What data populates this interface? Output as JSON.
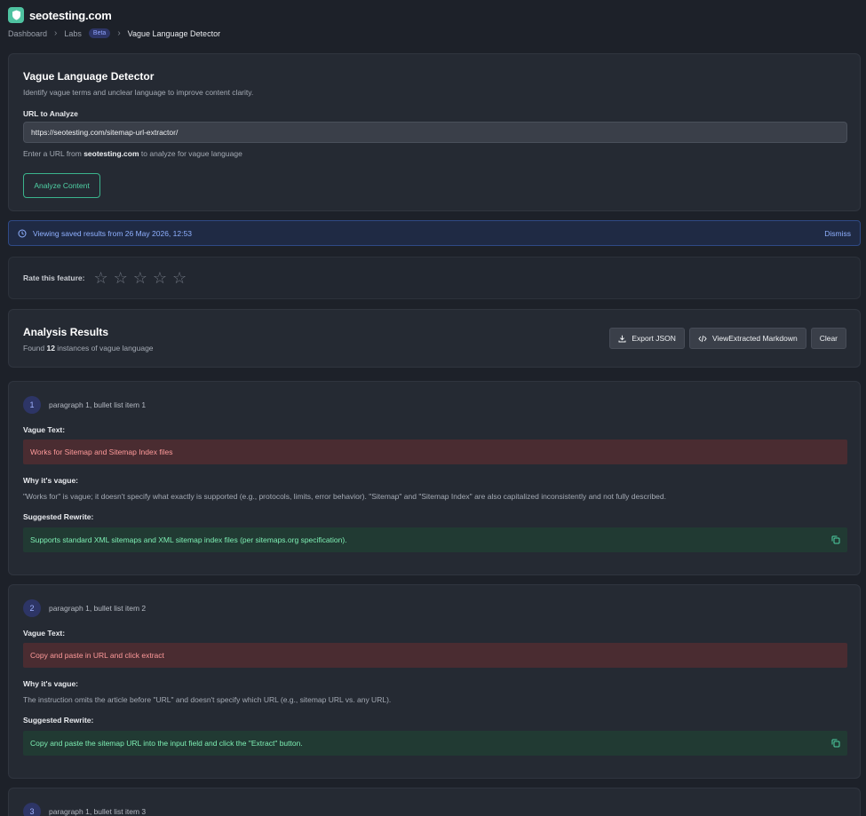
{
  "brand": {
    "name": "seotesting.com",
    "logo_icon": "shield-icon",
    "accent": "#4fc3a1"
  },
  "breadcrumb": {
    "items": [
      "Dashboard",
      "Labs"
    ],
    "badge": "Beta",
    "current": "Vague Language Detector"
  },
  "tool": {
    "title": "Vague Language Detector",
    "description": "Identify vague terms and unclear language to improve content clarity.",
    "url_label": "URL to Analyze",
    "url_value": "https://seotesting.com/sitemap-url-extractor/",
    "hint_prefix": "Enter a URL from ",
    "hint_domain": "seotesting.com",
    "hint_suffix": " to analyze for vague language",
    "analyze_label": "Analyze Content"
  },
  "saved_notice": {
    "text": "Viewing saved results from 26 May 2026, 12:53",
    "dismiss_label": "Dismiss"
  },
  "rating": {
    "label": "Rate this feature:",
    "max": 5,
    "value": 0
  },
  "results": {
    "title": "Analysis Results",
    "found_prefix": "Found ",
    "count": "12",
    "found_suffix": " instances of vague language",
    "export_label": "Export JSON",
    "markdown_label": "ViewExtracted Markdown",
    "clear_label": "Clear"
  },
  "labels": {
    "vague_text": "Vague Text:",
    "why": "Why it's vague:",
    "rewrite": "Suggested Rewrite:"
  },
  "items": [
    {
      "number": "1",
      "location": "paragraph 1, bullet list item 1",
      "vague_text": "Works for Sitemap and Sitemap Index files",
      "why": "\"Works for\" is vague; it doesn't specify what exactly is supported (e.g., protocols, limits, error behavior). \"Sitemap\" and \"Sitemap Index\" are also capitalized inconsistently and not fully described.",
      "rewrite": "Supports standard XML sitemaps and XML sitemap index files (per sitemaps.org specification)."
    },
    {
      "number": "2",
      "location": "paragraph 1, bullet list item 2",
      "vague_text": "Copy and paste in URL and click extract",
      "why": "The instruction omits the article before \"URL\" and doesn't specify which URL (e.g., sitemap URL vs. any URL).",
      "rewrite": "Copy and paste the sitemap URL into the input field and click the \"Extract\" button."
    },
    {
      "number": "3",
      "location": "paragraph 1, bullet list item 3"
    }
  ]
}
